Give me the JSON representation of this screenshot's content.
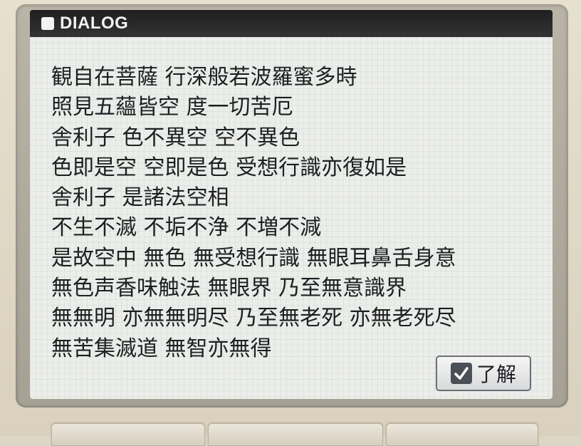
{
  "dialog": {
    "title": "DIALOG",
    "lines": [
      "観自在菩薩 行深般若波羅蜜多時",
      "照見五蘊皆空 度一切苦厄",
      "舎利子 色不異空 空不異色",
      "色即是空 空即是色 受想行識亦復如是",
      "舎利子 是諸法空相",
      "不生不滅 不垢不浄 不増不減",
      "是故空中 無色 無受想行識 無眼耳鼻舌身意",
      "無色声香味触法 無眼界 乃至無意識界",
      "無無明 亦無無明尽 乃至無老死 亦無老死尽",
      "無苦集滅道 無智亦無得"
    ],
    "ok_button": {
      "label": "了解",
      "icon": "checkmark-icon"
    }
  },
  "colors": {
    "titlebar": "#1f1f1f",
    "title_text": "#f2f2f2",
    "content_bg": "#eceeea",
    "text": "#1e1f22",
    "device_body": "#ddd6c4"
  }
}
